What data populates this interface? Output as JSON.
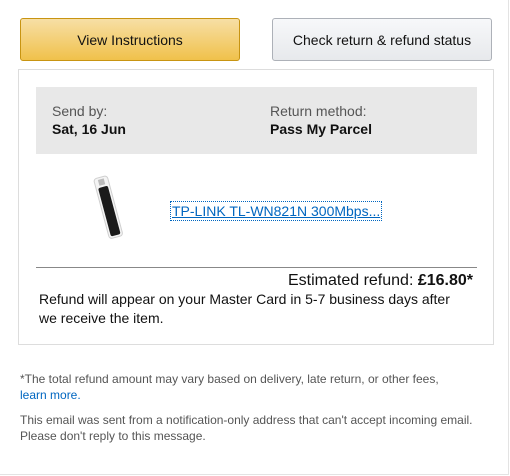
{
  "buttons": {
    "view_instructions": "View Instructions",
    "check_status": "Check return & refund status"
  },
  "return_info": {
    "send_by_label": "Send by:",
    "send_by_value": "Sat, 16 Jun",
    "method_label": "Return method:",
    "method_value": "Pass My Parcel"
  },
  "product": {
    "name": "TP-LINK TL-WN821N 300Mbps...",
    "image_icon": "usb-wifi-adapter"
  },
  "refund": {
    "label": "Estimated refund: ",
    "amount": "£16.80*",
    "note": "Refund will appear on your Master Card in 5-7 business days after we receive the item."
  },
  "footer": {
    "disclaimer": "*The total refund amount may vary based on delivery, late return, or other fees,",
    "learn_more": "learn more.",
    "notice": "This email was sent from a notification-only address that can't accept incoming email. Please don't reply to this message."
  },
  "colors": {
    "primary_button": "#f0c14b",
    "link": "#0066c0",
    "info_bg": "#e8e8e8"
  }
}
